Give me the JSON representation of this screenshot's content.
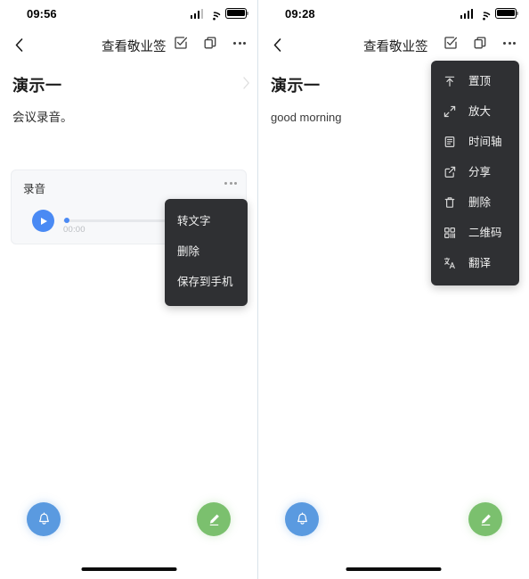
{
  "panels": [
    {
      "id": "left",
      "statusbar": {
        "time": "09:56",
        "signal_icon": "cellular-signal-icon",
        "wifi_icon": "wifi-icon",
        "battery_icon": "battery-icon"
      },
      "navbar": {
        "back_icon": "chevron-left-icon",
        "title": "查看敬业签",
        "actions": [
          {
            "name": "checkbox-check-icon",
            "label": ""
          },
          {
            "name": "copy-icon",
            "label": ""
          },
          {
            "name": "more-dots-icon",
            "label": ""
          }
        ]
      },
      "note": {
        "title": "演示一",
        "body": "会议录音。",
        "chevron_icon": "chevron-right-icon"
      },
      "audio_card": {
        "title": "录音",
        "more_icon": "more-dots-icon",
        "play_icon": "play-icon",
        "elapsed": "00:00",
        "progress_percent": 0
      },
      "context_menu": {
        "items": [
          {
            "label": "转文字",
            "icon": ""
          },
          {
            "label": "删除",
            "icon": ""
          },
          {
            "label": "保存到手机",
            "icon": ""
          }
        ]
      },
      "fabs": {
        "bell": {
          "name": "bell-icon",
          "color": "#5a9ae0"
        },
        "edit": {
          "name": "pencil-edit-icon",
          "color": "#7bc06e"
        }
      }
    },
    {
      "id": "right",
      "statusbar": {
        "time": "09:28",
        "signal_icon": "cellular-signal-icon",
        "wifi_icon": "wifi-icon",
        "battery_icon": "battery-icon"
      },
      "navbar": {
        "back_icon": "chevron-left-icon",
        "title": "查看敬业签",
        "actions": [
          {
            "name": "checkbox-check-icon",
            "label": ""
          },
          {
            "name": "copy-icon",
            "label": ""
          },
          {
            "name": "more-dots-icon",
            "label": ""
          }
        ]
      },
      "note": {
        "title": "演示一",
        "body": "good morning",
        "chevron_icon": ""
      },
      "context_menu": {
        "items": [
          {
            "label": "置顶",
            "icon": "pin-to-top-icon"
          },
          {
            "label": "放大",
            "icon": "expand-icon"
          },
          {
            "label": "时间轴",
            "icon": "timeline-document-icon"
          },
          {
            "label": "分享",
            "icon": "share-icon"
          },
          {
            "label": "删除",
            "icon": "trash-icon"
          },
          {
            "label": "二维码",
            "icon": "qrcode-icon"
          },
          {
            "label": "翻译",
            "icon": "translate-icon"
          }
        ]
      },
      "fabs": {
        "bell": {
          "name": "bell-icon",
          "color": "#5a9ae0"
        },
        "edit": {
          "name": "pencil-edit-icon",
          "color": "#7bc06e"
        }
      }
    }
  ],
  "colors": {
    "accent_blue": "#4a8af4",
    "fab_blue": "#5a9ae0",
    "fab_green": "#7bc06e",
    "menu_bg": "#2f3033",
    "card_bg": "#f7f8fa"
  }
}
